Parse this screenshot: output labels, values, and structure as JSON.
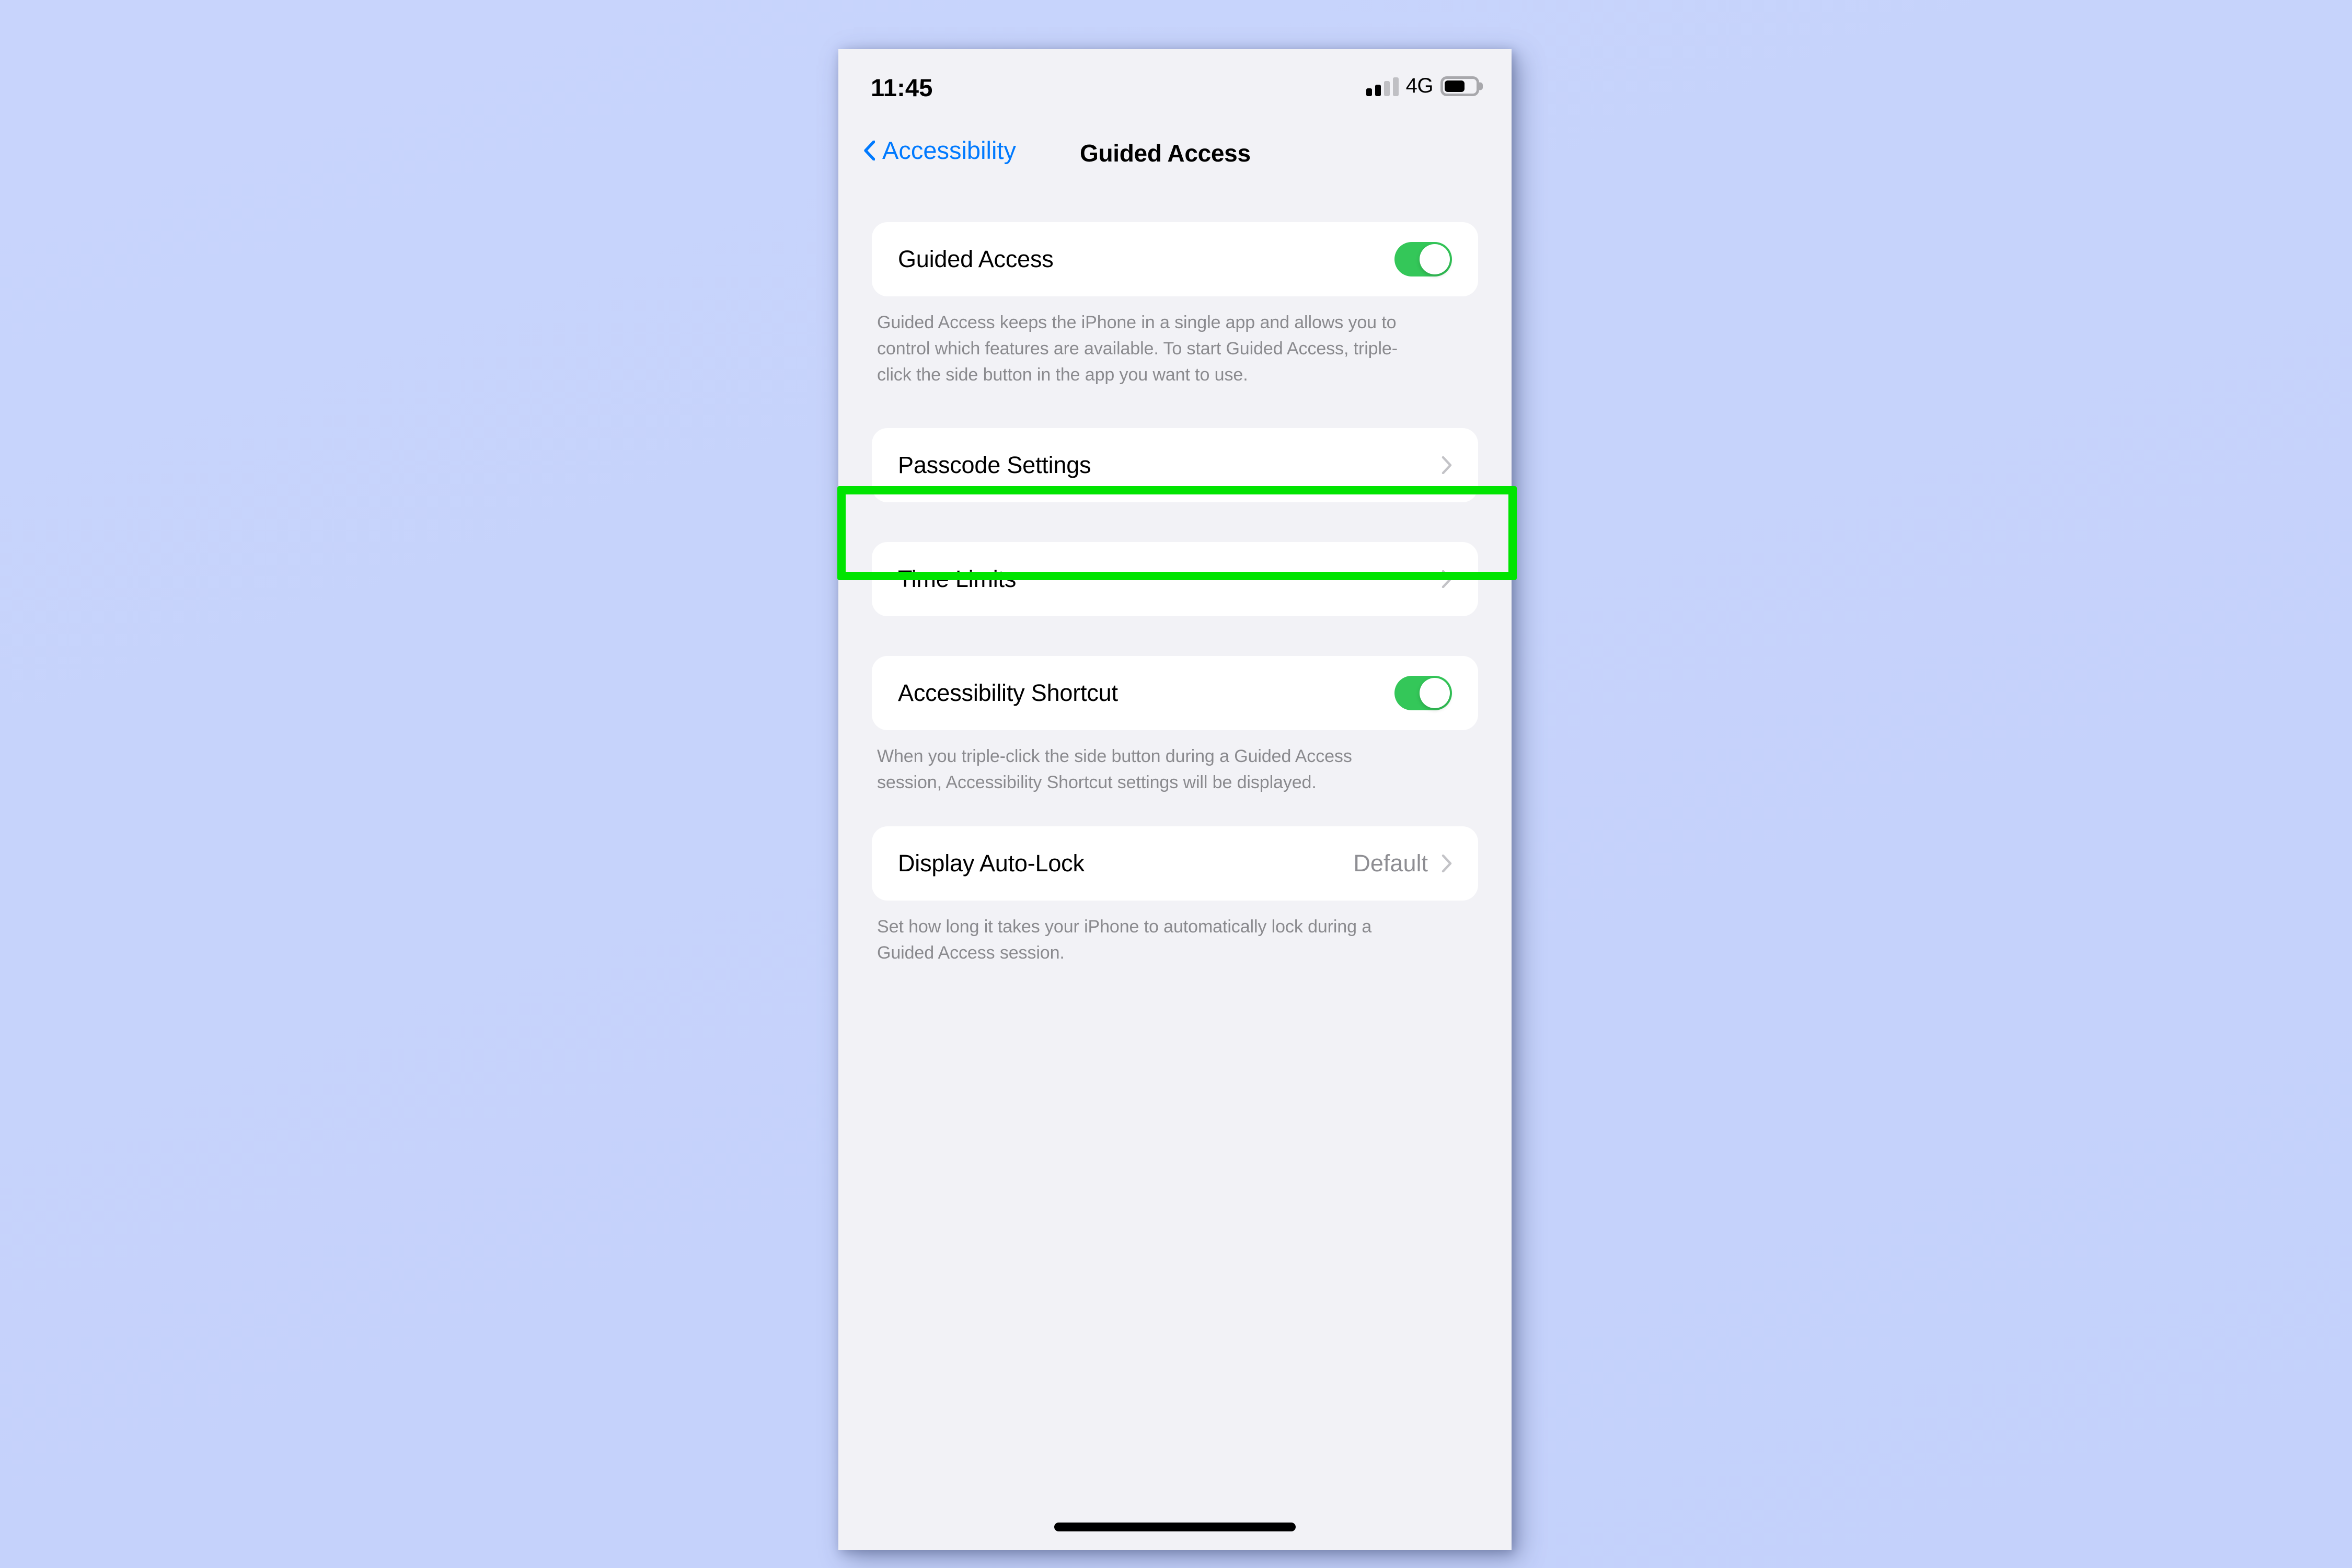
{
  "status_bar": {
    "time": "11:45",
    "network": "4G",
    "signal_icon": "cellular-signal-icon",
    "battery_icon": "battery-icon"
  },
  "nav": {
    "back_label": "Accessibility",
    "back_icon": "chevron-left-icon",
    "title": "Guided Access"
  },
  "sections": {
    "guided_access": {
      "label": "Guided Access",
      "toggle_state": "on",
      "footnote": "Guided Access keeps the iPhone in a single app and allows you to control which features are available. To start Guided Access, triple-click the side button in the app you want to use."
    },
    "passcode_settings": {
      "label": "Passcode Settings",
      "chevron_icon": "chevron-right-icon"
    },
    "time_limits": {
      "label": "Time Limits",
      "chevron_icon": "chevron-right-icon"
    },
    "accessibility_shortcut": {
      "label": "Accessibility Shortcut",
      "toggle_state": "on",
      "footnote": "When you triple-click the side button during a Guided Access session, Accessibility Shortcut settings will be displayed."
    },
    "display_auto_lock": {
      "label": "Display Auto-Lock",
      "value": "Default",
      "chevron_icon": "chevron-right-icon",
      "footnote": "Set how long it takes your iPhone to automatically lock during a Guided Access session."
    }
  },
  "highlight": {
    "target": "passcode-settings-row",
    "color": "#00e400"
  },
  "colors": {
    "accent_blue": "#007aff",
    "toggle_green": "#34c759",
    "screen_background": "#f2f2f6",
    "card_background": "#ffffff",
    "footnote_text": "#8a8a8e",
    "page_background": "#c6d3fb"
  }
}
